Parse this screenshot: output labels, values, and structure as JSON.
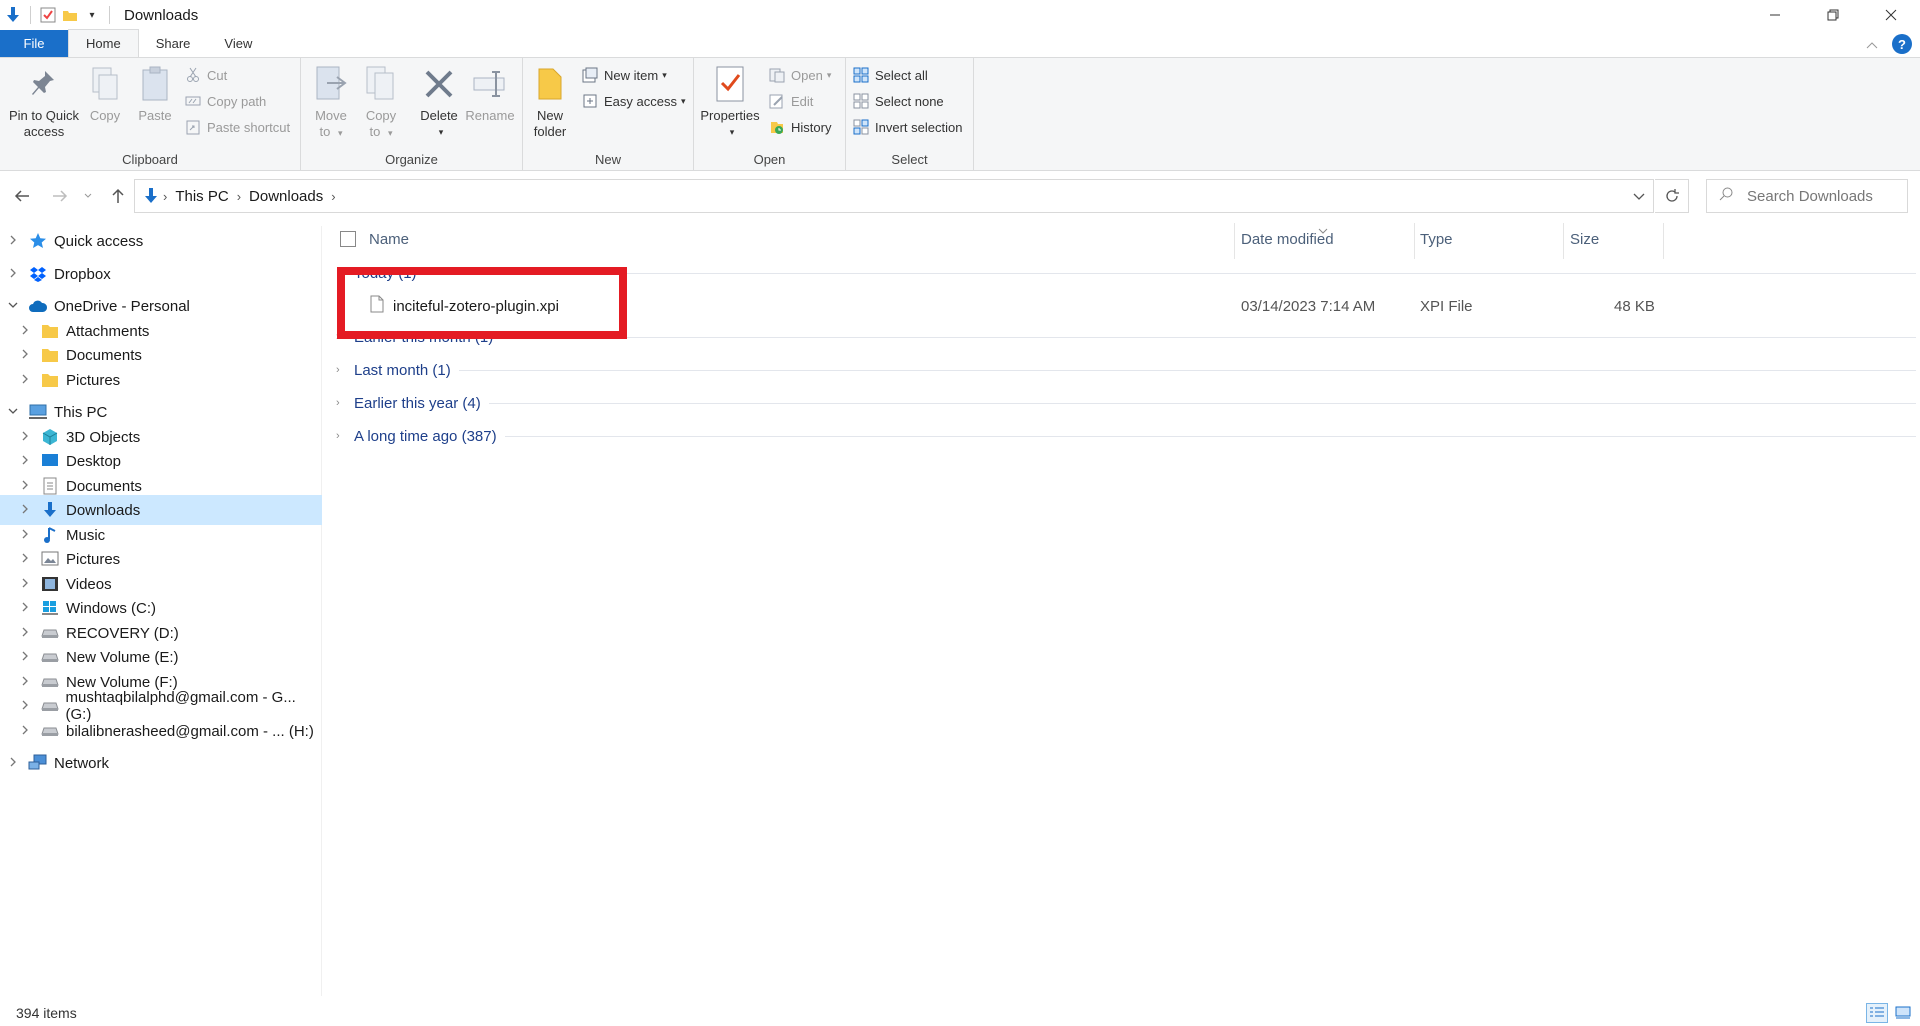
{
  "window": {
    "title": "Downloads",
    "controls": {
      "minimize": "—",
      "maximize": "❐",
      "close": "✕"
    }
  },
  "ribbon_tabs": [
    {
      "label": "File"
    },
    {
      "label": "Home"
    },
    {
      "label": "Share"
    },
    {
      "label": "View"
    }
  ],
  "ribbon": {
    "clipboard": {
      "label": "Clipboard",
      "pin": "Pin to Quick access",
      "pin_line1": "Pin to Quick",
      "pin_line2": "access",
      "copy": "Copy",
      "paste": "Paste",
      "cut": "Cut",
      "copy_path": "Copy path",
      "paste_shortcut": "Paste shortcut"
    },
    "organize": {
      "label": "Organize",
      "move_to_1": "Move",
      "move_to_2": "to",
      "copy_to_1": "Copy",
      "copy_to_2": "to",
      "delete": "Delete",
      "rename": "Rename"
    },
    "new": {
      "label": "New",
      "new_folder_1": "New",
      "new_folder_2": "folder",
      "new_item": "New item",
      "easy_access": "Easy access"
    },
    "open": {
      "label": "Open",
      "properties": "Properties",
      "open": "Open",
      "edit": "Edit",
      "history": "History"
    },
    "select": {
      "label": "Select",
      "select_all": "Select all",
      "select_none": "Select none",
      "invert_selection": "Invert selection"
    }
  },
  "address": {
    "crumbs": [
      "This PC",
      "Downloads"
    ],
    "search_placeholder": "Search Downloads"
  },
  "nav_pane": [
    {
      "label": "Quick access",
      "indent": 0,
      "expanded": false,
      "icon": "star-icon"
    },
    {
      "label": "Dropbox",
      "indent": 0,
      "expanded": false,
      "icon": "dropbox-icon"
    },
    {
      "label": "OneDrive - Personal",
      "indent": 0,
      "expanded": true,
      "icon": "cloud-icon"
    },
    {
      "label": "Attachments",
      "indent": 1,
      "expanded": false,
      "icon": "folder-icon"
    },
    {
      "label": "Documents",
      "indent": 1,
      "expanded": false,
      "icon": "folder-icon"
    },
    {
      "label": "Pictures",
      "indent": 1,
      "expanded": false,
      "icon": "folder-icon"
    },
    {
      "label": "This PC",
      "indent": 0,
      "expanded": true,
      "icon": "computer-icon"
    },
    {
      "label": "3D Objects",
      "indent": 1,
      "expanded": false,
      "icon": "cube-icon"
    },
    {
      "label": "Desktop",
      "indent": 1,
      "expanded": false,
      "icon": "desktop-icon"
    },
    {
      "label": "Documents",
      "indent": 1,
      "expanded": false,
      "icon": "documents-icon"
    },
    {
      "label": "Downloads",
      "indent": 1,
      "expanded": false,
      "icon": "download-icon",
      "selected": true
    },
    {
      "label": "Music",
      "indent": 1,
      "expanded": false,
      "icon": "music-icon"
    },
    {
      "label": "Pictures",
      "indent": 1,
      "expanded": false,
      "icon": "pictures-icon"
    },
    {
      "label": "Videos",
      "indent": 1,
      "expanded": false,
      "icon": "videos-icon"
    },
    {
      "label": "Windows (C:)",
      "indent": 1,
      "expanded": false,
      "icon": "windows-drive-icon"
    },
    {
      "label": "RECOVERY (D:)",
      "indent": 1,
      "expanded": false,
      "icon": "drive-icon"
    },
    {
      "label": "New Volume (E:)",
      "indent": 1,
      "expanded": false,
      "icon": "drive-icon"
    },
    {
      "label": "New Volume (F:)",
      "indent": 1,
      "expanded": false,
      "icon": "drive-icon"
    },
    {
      "label": "mushtaqbilalphd@gmail.com - G... (G:)",
      "indent": 1,
      "expanded": false,
      "icon": "drive-icon"
    },
    {
      "label": "bilalibnerasheed@gmail.com - ... (H:)",
      "indent": 1,
      "expanded": false,
      "icon": "drive-icon"
    },
    {
      "label": "Network",
      "indent": 0,
      "expanded": false,
      "icon": "network-icon"
    }
  ],
  "columns": {
    "name": "Name",
    "date_modified": "Date modified",
    "type": "Type",
    "size": "Size"
  },
  "groups": [
    {
      "label": "Today (1)",
      "expanded": true
    },
    {
      "label": "Earlier this month (1)",
      "expanded": false
    },
    {
      "label": "Last month (1)",
      "expanded": false
    },
    {
      "label": "Earlier this year (4)",
      "expanded": false
    },
    {
      "label": "A long time ago (387)",
      "expanded": false
    }
  ],
  "files": [
    {
      "name": "inciteful-zotero-plugin.xpi",
      "date": "03/14/2023 7:14 AM",
      "type": "XPI File",
      "size": "48 KB"
    }
  ],
  "status": {
    "count": "394 items"
  },
  "colors": {
    "accent": "#1a6fc9",
    "selection": "#cce8ff",
    "highlight": "#e41b23",
    "group_text": "#1e3f8a"
  }
}
